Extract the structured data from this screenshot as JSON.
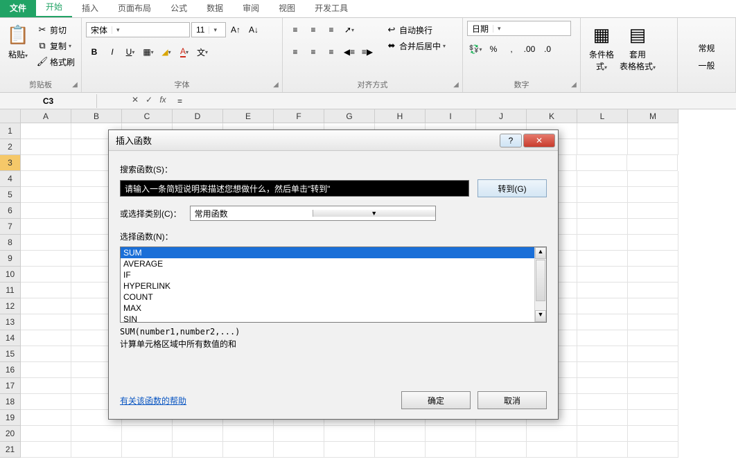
{
  "tabs": {
    "file": "文件",
    "home": "开始",
    "insert": "插入",
    "layout": "页面布局",
    "formula": "公式",
    "data": "数据",
    "review": "审阅",
    "view": "视图",
    "dev": "开发工具"
  },
  "clipboard": {
    "paste": "粘贴",
    "cut": "剪切",
    "copy": "复制",
    "format": "格式刷",
    "group": "剪贴板"
  },
  "font": {
    "name": "宋体",
    "size": "11",
    "group": "字体"
  },
  "align": {
    "autowrap": "自动换行",
    "merge": "合并后居中",
    "group": "对齐方式"
  },
  "number": {
    "format": "日期",
    "group": "数字"
  },
  "styles": {
    "cond": "条件格式",
    "table": "套用\n表格格式"
  },
  "cells": {
    "normal": "常规",
    "general": "一般"
  },
  "formula_bar": {
    "cell": "C3",
    "value": "="
  },
  "columns": [
    "A",
    "B",
    "C",
    "D",
    "E",
    "F",
    "G",
    "H",
    "I",
    "J",
    "K",
    "L",
    "M"
  ],
  "rows_count": 21,
  "selected_row": 3,
  "dialog": {
    "title": "插入函数",
    "search_label": "搜索函数(S)：",
    "search_text": "请输入一条简短说明来描述您想做什么，然后单击\"转到\"",
    "go": "转到(G)",
    "cat_label": "或选择类别(C)：",
    "cat_value": "常用函数",
    "select_label": "选择函数(N)：",
    "funcs": [
      "SUM",
      "AVERAGE",
      "IF",
      "HYPERLINK",
      "COUNT",
      "MAX",
      "SIN"
    ],
    "signature": "SUM(number1,number2,...)",
    "desc": "计算单元格区域中所有数值的和",
    "help": "有关该函数的帮助",
    "ok": "确定",
    "cancel": "取消"
  }
}
